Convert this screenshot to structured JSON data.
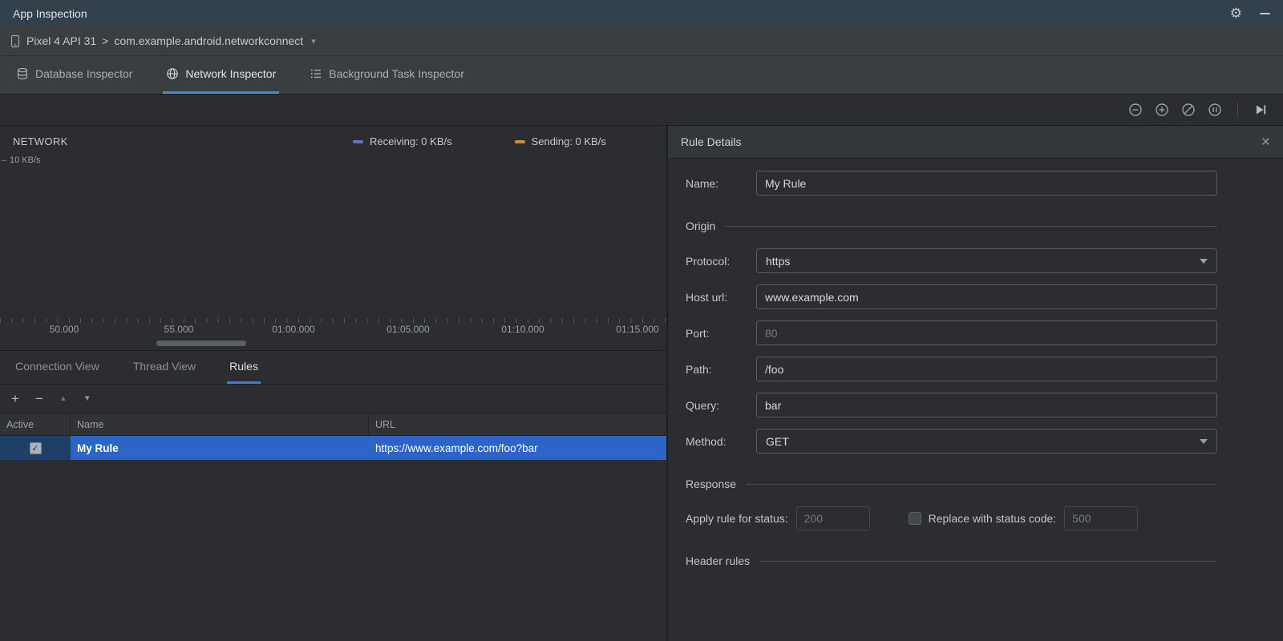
{
  "colors": {
    "accent_blue": "#3e7ece",
    "selection_blue": "#2d64c8",
    "receiving_color": "#6379bd",
    "sending_color": "#d0894f"
  },
  "title_bar": {
    "title": "App Inspection"
  },
  "device_bar": {
    "device": "Pixel 4 API 31",
    "separator": ">",
    "app": "com.example.android.networkconnect"
  },
  "inspector_tabs": [
    {
      "label": "Database Inspector"
    },
    {
      "label": "Network Inspector"
    },
    {
      "label": "Background Task Inspector"
    }
  ],
  "timeline": {
    "network_label": "NETWORK",
    "y_axis_label": "10 KB/s",
    "legend": [
      {
        "label": "Receiving: 0 KB/s",
        "color": "#6379bd"
      },
      {
        "label": "Sending: 0 KB/s",
        "color": "#d0894f"
      }
    ],
    "ticks": [
      "50.000",
      "55.000",
      "01:00.000",
      "01:05.000",
      "01:10.000",
      "01:15.000"
    ]
  },
  "view_tabs": [
    {
      "label": "Connection View"
    },
    {
      "label": "Thread View"
    },
    {
      "label": "Rules"
    }
  ],
  "rules_table": {
    "columns": [
      "Active",
      "Name",
      "URL"
    ],
    "checkmark": "✓",
    "rows": [
      {
        "active": "true",
        "name": "My Rule",
        "url": "https://www.example.com/foo?bar"
      }
    ]
  },
  "rule_details": {
    "title": "Rule Details",
    "close_label": "×",
    "name_label": "Name:",
    "name_value": "My Rule",
    "protocol_label": "Protocol:",
    "protocol_value": "https",
    "host_label": "Host url:",
    "host_value": "www.example.com",
    "port_label": "Port:",
    "port_placeholder": "80",
    "path_label": "Path:",
    "path_value": "/foo",
    "query_label": "Query:",
    "query_value": "bar",
    "method_label": "Method:",
    "method_value": "GET",
    "sections": {
      "origin": "Origin",
      "response": "Response",
      "header_rules": "Header rules"
    },
    "status_label": "Apply rule for status:",
    "status_placeholder": "200",
    "replace_label": "Replace with status code:",
    "replace_placeholder": "500"
  }
}
